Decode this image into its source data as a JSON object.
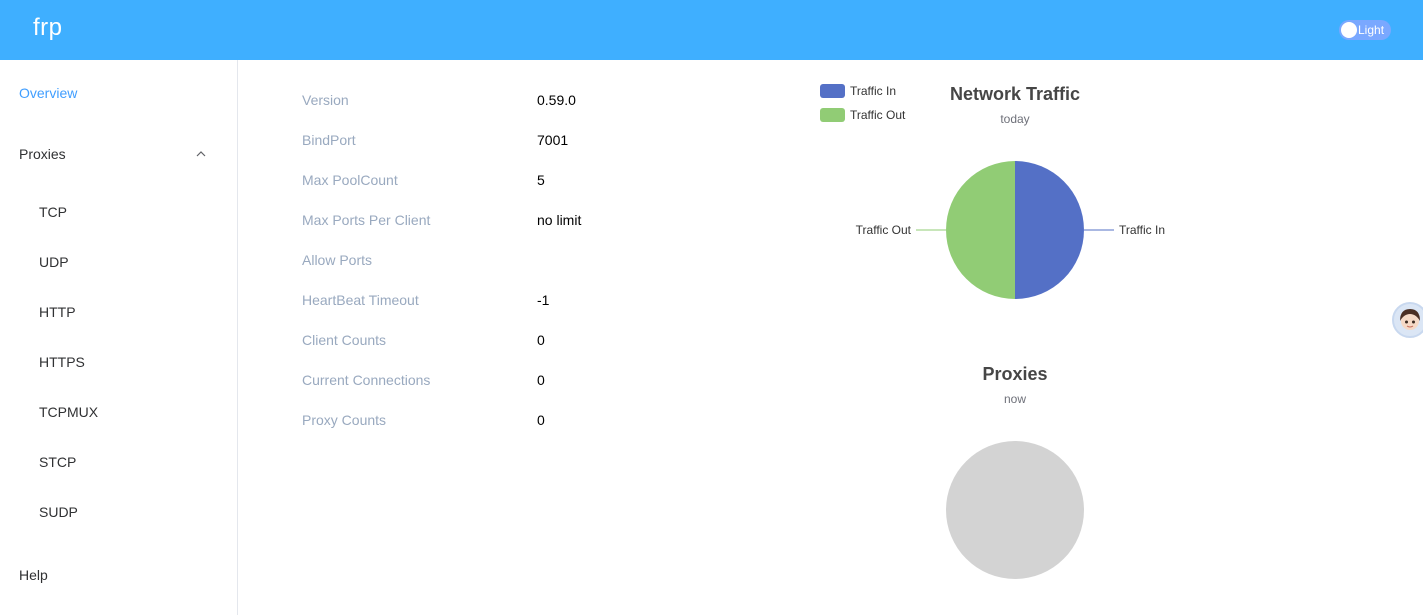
{
  "header": {
    "logo": "frp",
    "theme_label": "Light"
  },
  "sidebar": {
    "overview": "Overview",
    "proxies": "Proxies",
    "items": [
      "TCP",
      "UDP",
      "HTTP",
      "HTTPS",
      "TCPMUX",
      "STCP",
      "SUDP"
    ],
    "help": "Help"
  },
  "server_info": [
    {
      "label": "Version",
      "value": "0.59.0"
    },
    {
      "label": "BindPort",
      "value": "7001"
    },
    {
      "label": "Max PoolCount",
      "value": "5"
    },
    {
      "label": "Max Ports Per Client",
      "value": "no limit"
    },
    {
      "label": "Allow Ports",
      "value": ""
    },
    {
      "label": "HeartBeat Timeout",
      "value": "-1"
    },
    {
      "label": "Client Counts",
      "value": "0"
    },
    {
      "label": "Current Connections",
      "value": "0"
    },
    {
      "label": "Proxy Counts",
      "value": "0"
    }
  ],
  "chart_data": [
    {
      "type": "pie",
      "title": "Network Traffic",
      "subtitle": "today",
      "legend_position": "top-left",
      "slices": [
        {
          "name": "Traffic In",
          "value": 50,
          "color": "#5470c6"
        },
        {
          "name": "Traffic Out",
          "value": 50,
          "color": "#91cc75"
        }
      ]
    },
    {
      "type": "pie",
      "title": "Proxies",
      "subtitle": "now",
      "slices": [],
      "empty_color": "#d3d3d3"
    }
  ],
  "colors": {
    "header": "#3fafff",
    "active_menu": "#409eff",
    "label": "#99a9bf"
  },
  "icons": {
    "collapse": "chevron-up-icon",
    "assistant": "avatar-icon"
  }
}
